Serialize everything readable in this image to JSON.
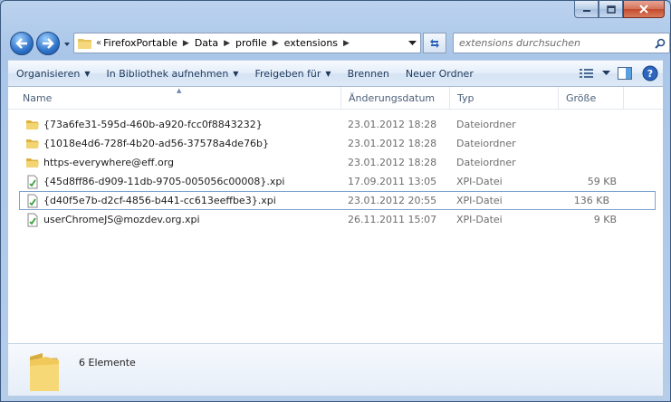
{
  "window": {
    "caption": {
      "minimize": "minimize-icon",
      "maximize": "maximize-icon",
      "close": "close-icon"
    }
  },
  "address": {
    "overflow": "«",
    "segments": [
      "FirefoxPortable",
      "Data",
      "profile",
      "extensions"
    ]
  },
  "search": {
    "placeholder": "extensions durchsuchen"
  },
  "toolbar": {
    "organize": "Organisieren",
    "library": "In Bibliothek aufnehmen",
    "share": "Freigeben für",
    "burn": "Brennen",
    "new_folder": "Neuer Ordner"
  },
  "columns": {
    "name": "Name",
    "date": "Änderungsdatum",
    "type": "Typ",
    "size": "Größe"
  },
  "files": [
    {
      "name": "{73a6fe31-595d-460b-a920-fcc0f8843232}",
      "date": "23.01.2012 18:28",
      "type": "Dateiordner",
      "size": "",
      "icon": "folder-icon"
    },
    {
      "name": "{1018e4d6-728f-4b20-ad56-37578a4de76b}",
      "date": "23.01.2012 18:28",
      "type": "Dateiordner",
      "size": "",
      "icon": "folder-icon"
    },
    {
      "name": "https-everywhere@eff.org",
      "date": "23.01.2012 18:28",
      "type": "Dateiordner",
      "size": "",
      "icon": "folder-icon"
    },
    {
      "name": "{45d8ff86-d909-11db-9705-005056c00008}.xpi",
      "date": "17.09.2011 13:05",
      "type": "XPI-Datei",
      "size": "59 KB",
      "icon": "xpi-file-icon"
    },
    {
      "name": "{d40f5e7b-d2cf-4856-b441-cc613eeffbe3}.xpi",
      "date": "23.01.2012 20:55",
      "type": "XPI-Datei",
      "size": "136 KB",
      "icon": "xpi-file-icon"
    },
    {
      "name": "userChromeJS@mozdev.org.xpi",
      "date": "26.11.2011 15:07",
      "type": "XPI-Datei",
      "size": "9 KB",
      "icon": "xpi-file-icon"
    }
  ],
  "status": {
    "count": "6 Elemente"
  },
  "colors": {
    "accent": "#1e395b",
    "focus": "#7da2ce"
  }
}
